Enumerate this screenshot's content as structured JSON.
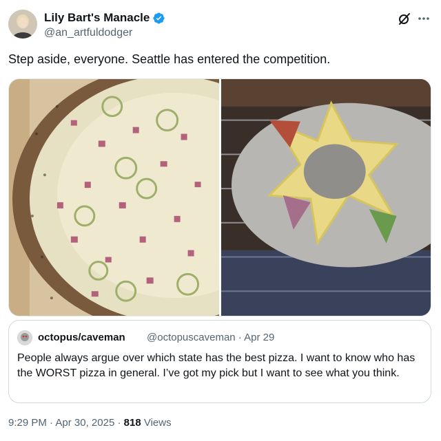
{
  "author": {
    "name": "Lily Bart's Manacle",
    "handle": "@an_artfuldodger",
    "verified": true
  },
  "icons": {
    "verified": "verified-badge-icon",
    "grok": "grok-icon",
    "more": "more-options-icon"
  },
  "post": {
    "text": "Step aside, everyone. Seattle has entered the competition."
  },
  "media": [
    {
      "label": "pizza-photo"
    },
    {
      "label": "star-crust-pizza-photo"
    }
  ],
  "quote": {
    "name": "octopus/caveman",
    "handle": "@octopuscaveman · Apr 29",
    "text": "People always argue over which state has the best pizza. I want to know who has the WORST pizza in general. I’ve got my pick but I want to see what you think."
  },
  "meta": {
    "time": "9:29 PM",
    "separator": " · ",
    "date": "Apr 30, 2025",
    "views_count": "818",
    "views_label": "Views"
  },
  "colors": {
    "text_primary": "#0f1419",
    "text_secondary": "#536471",
    "verified_blue": "#1d9bf0",
    "border": "#cfd9de"
  }
}
